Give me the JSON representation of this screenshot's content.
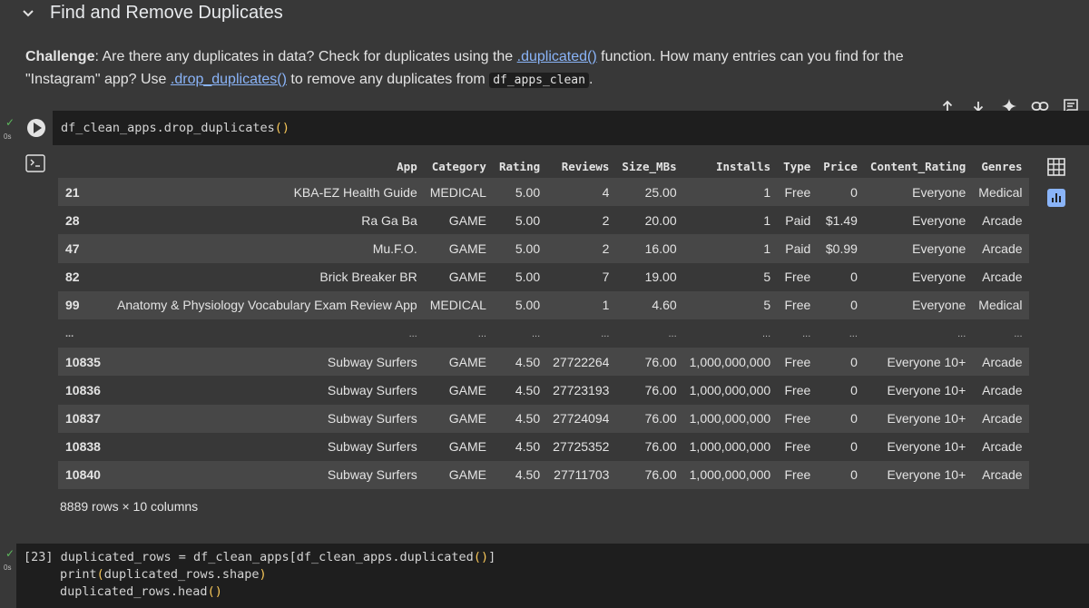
{
  "markdown": {
    "title": "Find and Remove Duplicates",
    "para_bold": "Challenge",
    "para_1": ": Are there any duplicates in data? Check for duplicates using the ",
    "link_duplicated": ".duplicated()",
    "para_2": " function. How many entries can you find for the \"Instagram\" app? Use ",
    "link_drop": ".drop_duplicates()",
    "para_3": " to remove any duplicates from ",
    "code_var": "df_apps_clean",
    "para_4": "."
  },
  "toolbar": {
    "icons": [
      "arrow-up-icon",
      "arrow-down-icon",
      "sparkle-icon",
      "link-icon",
      "comment-icon"
    ]
  },
  "cell1": {
    "status_check": "✓",
    "exec_time": "0s",
    "code_obj": "df_clean_apps.drop_duplicates",
    "code_parens": "()"
  },
  "dataframe": {
    "columns": [
      "",
      "App",
      "Category",
      "Rating",
      "Reviews",
      "Size_MBs",
      "Installs",
      "Type",
      "Price",
      "Content_Rating",
      "Genres"
    ],
    "rows": [
      [
        "21",
        "KBA-EZ Health Guide",
        "MEDICAL",
        "5.00",
        "4",
        "25.00",
        "1",
        "Free",
        "0",
        "Everyone",
        "Medical"
      ],
      [
        "28",
        "Ra Ga Ba",
        "GAME",
        "5.00",
        "2",
        "20.00",
        "1",
        "Paid",
        "$1.49",
        "Everyone",
        "Arcade"
      ],
      [
        "47",
        "Mu.F.O.",
        "GAME",
        "5.00",
        "2",
        "16.00",
        "1",
        "Paid",
        "$0.99",
        "Everyone",
        "Arcade"
      ],
      [
        "82",
        "Brick Breaker BR",
        "GAME",
        "5.00",
        "7",
        "19.00",
        "5",
        "Free",
        "0",
        "Everyone",
        "Arcade"
      ],
      [
        "99",
        "Anatomy & Physiology Vocabulary Exam Review App",
        "MEDICAL",
        "5.00",
        "1",
        "4.60",
        "5",
        "Free",
        "0",
        "Everyone",
        "Medical"
      ],
      [
        "...",
        "...",
        "...",
        "...",
        "...",
        "...",
        "...",
        "...",
        "...",
        "...",
        "..."
      ],
      [
        "10835",
        "Subway Surfers",
        "GAME",
        "4.50",
        "27722264",
        "76.00",
        "1,000,000,000",
        "Free",
        "0",
        "Everyone 10+",
        "Arcade"
      ],
      [
        "10836",
        "Subway Surfers",
        "GAME",
        "4.50",
        "27723193",
        "76.00",
        "1,000,000,000",
        "Free",
        "0",
        "Everyone 10+",
        "Arcade"
      ],
      [
        "10837",
        "Subway Surfers",
        "GAME",
        "4.50",
        "27724094",
        "76.00",
        "1,000,000,000",
        "Free",
        "0",
        "Everyone 10+",
        "Arcade"
      ],
      [
        "10838",
        "Subway Surfers",
        "GAME",
        "4.50",
        "27725352",
        "76.00",
        "1,000,000,000",
        "Free",
        "0",
        "Everyone 10+",
        "Arcade"
      ],
      [
        "10840",
        "Subway Surfers",
        "GAME",
        "4.50",
        "27711703",
        "76.00",
        "1,000,000,000",
        "Free",
        "0",
        "Everyone 10+",
        "Arcade"
      ]
    ],
    "shape_text": "8889 rows × 10 columns"
  },
  "cell2": {
    "status_check": "✓",
    "exec_time": "0s",
    "exec_count": "[23]",
    "line1_a": "duplicated_rows = df_clean_apps[df_clean_apps.duplicated",
    "line1_p": "()",
    "line1_b": "]",
    "line2_a": "print",
    "line2_p1": "(",
    "line2_b": "duplicated_rows.shape",
    "line2_p2": ")",
    "line3_a": "duplicated_rows.head",
    "line3_p": "()"
  }
}
